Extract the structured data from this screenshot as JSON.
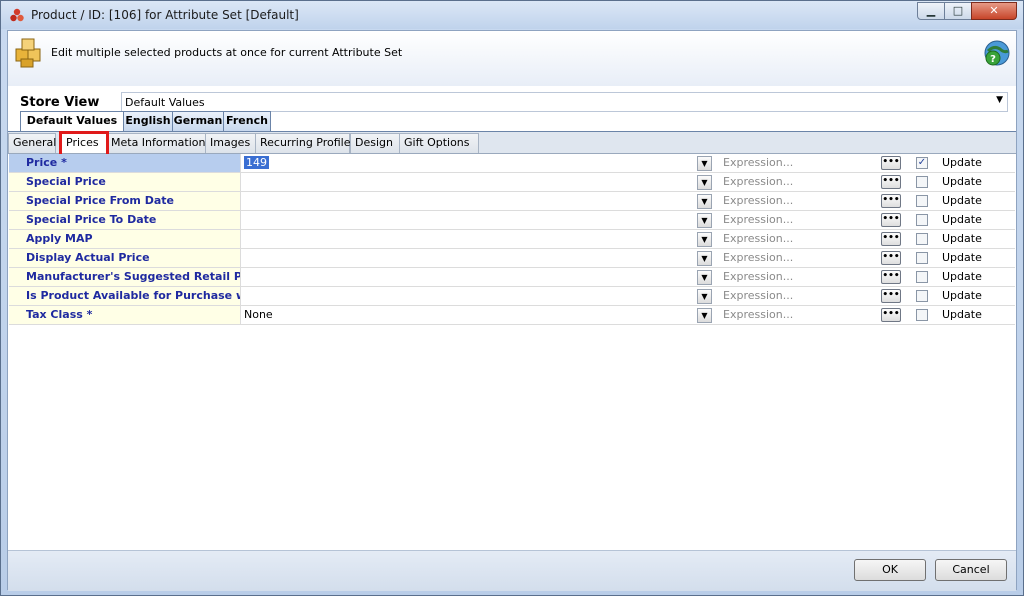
{
  "window": {
    "title": "Product / ID: [106] for Attribute Set [Default]",
    "minimize_glyph": "▁",
    "maximize_glyph": "□",
    "close_glyph": "✕"
  },
  "header": {
    "description": "Edit multiple selected products at once for current Attribute Set",
    "icon": "boxes-icon",
    "help_icon": "help-globe-icon"
  },
  "store_view": {
    "label": "Store View",
    "selected": "Default Values",
    "arrow": "▼",
    "tabs": [
      "Default Values",
      "English",
      "German",
      "French"
    ],
    "active_tab": "Default Values"
  },
  "tabs": {
    "items": [
      "General",
      "Prices",
      "Meta Information",
      "Images",
      "Recurring Profile",
      "Design",
      "Gift Options"
    ],
    "active": "Prices",
    "highlight_color": "#e01a1a"
  },
  "grid": {
    "expression_placeholder": "Expression...",
    "ellipsis": "•••",
    "dropdown_arrow": "▼",
    "update_label": "Update",
    "rows": [
      {
        "label": "Price *",
        "value": "149",
        "checked": true,
        "selected": true
      },
      {
        "label": "Special Price",
        "value": "",
        "checked": false
      },
      {
        "label": "Special Price From Date",
        "value": "",
        "checked": false
      },
      {
        "label": "Special Price To Date",
        "value": "",
        "checked": false
      },
      {
        "label": "Apply MAP",
        "value": "",
        "checked": false
      },
      {
        "label": "Display Actual Price",
        "value": "",
        "checked": false
      },
      {
        "label": "Manufacturer's Suggested Retail Price",
        "value": "",
        "checked": false
      },
      {
        "label": "Is Product Available for Purchase with Google Checkout",
        "value": "",
        "checked": false
      },
      {
        "label": "Tax Class *",
        "value": "None",
        "checked": false
      }
    ]
  },
  "footer": {
    "ok_label": "OK",
    "cancel_label": "Cancel"
  }
}
